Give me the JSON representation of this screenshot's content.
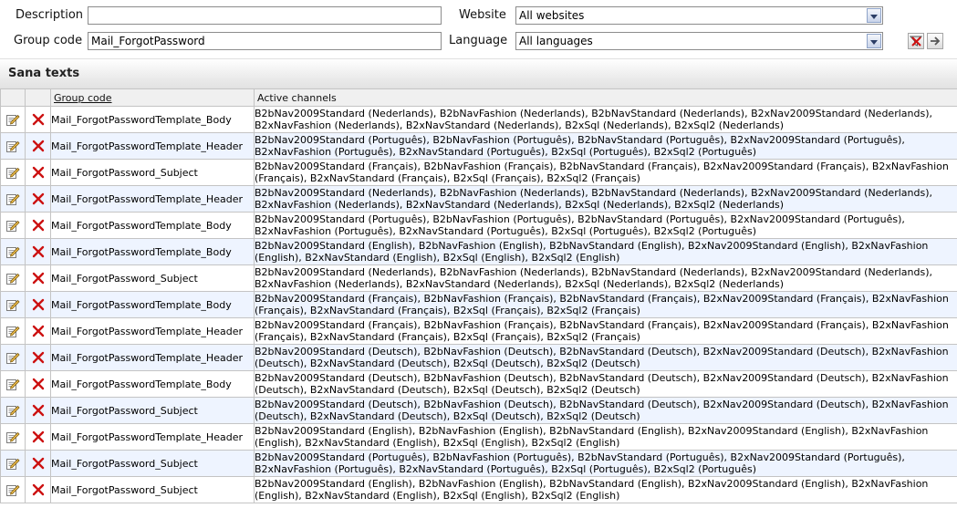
{
  "filters": {
    "description_label": "Description",
    "description_value": "",
    "group_code_label": "Group code",
    "group_code_value": "Mail_ForgotPassword",
    "website_label": "Website",
    "website_value": "All websites",
    "language_label": "Language",
    "language_value": "All languages"
  },
  "section": {
    "title": "Sana texts"
  },
  "table": {
    "columns": {
      "group_code": "Group code",
      "active_channels": "Active channels"
    },
    "rows": [
      {
        "code": "Mail_ForgotPasswordTemplate_Body",
        "channels": "B2bNav2009Standard (Nederlands), B2bNavFashion (Nederlands), B2bNavStandard (Nederlands), B2xNav2009Standard (Nederlands), B2xNavFashion (Nederlands), B2xNavStandard (Nederlands), B2xSql (Nederlands), B2xSql2 (Nederlands)"
      },
      {
        "code": "Mail_ForgotPasswordTemplate_Header",
        "channels": "B2bNav2009Standard (Português), B2bNavFashion (Português), B2bNavStandard (Português), B2xNav2009Standard (Português), B2xNavFashion (Português), B2xNavStandard (Português), B2xSql (Português), B2xSql2 (Português)"
      },
      {
        "code": "Mail_ForgotPassword_Subject",
        "channels": "B2bNav2009Standard (Français), B2bNavFashion (Français), B2bNavStandard (Français), B2xNav2009Standard (Français), B2xNavFashion (Français), B2xNavStandard (Français), B2xSql (Français), B2xSql2 (Français)"
      },
      {
        "code": "Mail_ForgotPasswordTemplate_Header",
        "channels": "B2bNav2009Standard (Nederlands), B2bNavFashion (Nederlands), B2bNavStandard (Nederlands), B2xNav2009Standard (Nederlands), B2xNavFashion (Nederlands), B2xNavStandard (Nederlands), B2xSql (Nederlands), B2xSql2 (Nederlands)"
      },
      {
        "code": "Mail_ForgotPasswordTemplate_Body",
        "channels": "B2bNav2009Standard (Português), B2bNavFashion (Português), B2bNavStandard (Português), B2xNav2009Standard (Português), B2xNavFashion (Português), B2xNavStandard (Português), B2xSql (Português), B2xSql2 (Português)"
      },
      {
        "code": "Mail_ForgotPasswordTemplate_Body",
        "channels": "B2bNav2009Standard (English), B2bNavFashion (English), B2bNavStandard (English), B2xNav2009Standard (English), B2xNavFashion (English), B2xNavStandard (English), B2xSql (English), B2xSql2 (English)"
      },
      {
        "code": "Mail_ForgotPassword_Subject",
        "channels": "B2bNav2009Standard (Nederlands), B2bNavFashion (Nederlands), B2bNavStandard (Nederlands), B2xNav2009Standard (Nederlands), B2xNavFashion (Nederlands), B2xNavStandard (Nederlands), B2xSql (Nederlands), B2xSql2 (Nederlands)"
      },
      {
        "code": "Mail_ForgotPasswordTemplate_Body",
        "channels": "B2bNav2009Standard (Français), B2bNavFashion (Français), B2bNavStandard (Français), B2xNav2009Standard (Français), B2xNavFashion (Français), B2xNavStandard (Français), B2xSql (Français), B2xSql2 (Français)"
      },
      {
        "code": "Mail_ForgotPasswordTemplate_Header",
        "channels": "B2bNav2009Standard (Français), B2bNavFashion (Français), B2bNavStandard (Français), B2xNav2009Standard (Français), B2xNavFashion (Français), B2xNavStandard (Français), B2xSql (Français), B2xSql2 (Français)"
      },
      {
        "code": "Mail_ForgotPasswordTemplate_Header",
        "channels": "B2bNav2009Standard (Deutsch), B2bNavFashion (Deutsch), B2bNavStandard (Deutsch), B2xNav2009Standard (Deutsch), B2xNavFashion (Deutsch), B2xNavStandard (Deutsch), B2xSql (Deutsch), B2xSql2 (Deutsch)"
      },
      {
        "code": "Mail_ForgotPasswordTemplate_Body",
        "channels": "B2bNav2009Standard (Deutsch), B2bNavFashion (Deutsch), B2bNavStandard (Deutsch), B2xNav2009Standard (Deutsch), B2xNavFashion (Deutsch), B2xNavStandard (Deutsch), B2xSql (Deutsch), B2xSql2 (Deutsch)"
      },
      {
        "code": "Mail_ForgotPassword_Subject",
        "channels": "B2bNav2009Standard (Deutsch), B2bNavFashion (Deutsch), B2bNavStandard (Deutsch), B2xNav2009Standard (Deutsch), B2xNavFashion (Deutsch), B2xNavStandard (Deutsch), B2xSql (Deutsch), B2xSql2 (Deutsch)"
      },
      {
        "code": "Mail_ForgotPasswordTemplate_Header",
        "channels": "B2bNav2009Standard (English), B2bNavFashion (English), B2bNavStandard (English), B2xNav2009Standard (English), B2xNavFashion (English), B2xNavStandard (English), B2xSql (English), B2xSql2 (English)"
      },
      {
        "code": "Mail_ForgotPassword_Subject",
        "channels": "B2bNav2009Standard (Português), B2bNavFashion (Português), B2bNavStandard (Português), B2xNav2009Standard (Português), B2xNavFashion (Português), B2xNavStandard (Português), B2xSql (Português), B2xSql2 (Português)"
      },
      {
        "code": "Mail_ForgotPassword_Subject",
        "channels": "B2bNav2009Standard (English), B2bNavFashion (English), B2bNavStandard (English), B2xNav2009Standard (English), B2xNavFashion (English), B2xNavStandard (English), B2xSql (English), B2xSql2 (English)"
      }
    ]
  },
  "icons": {
    "edit": "edit-icon",
    "delete": "delete-icon",
    "clear_filter": "clear-filter-icon",
    "apply_filter": "apply-filter-icon"
  },
  "colors": {
    "alt_row": "#eef4ff",
    "delete_red": "#cc1111",
    "section_bg": "#e2e2e2"
  }
}
